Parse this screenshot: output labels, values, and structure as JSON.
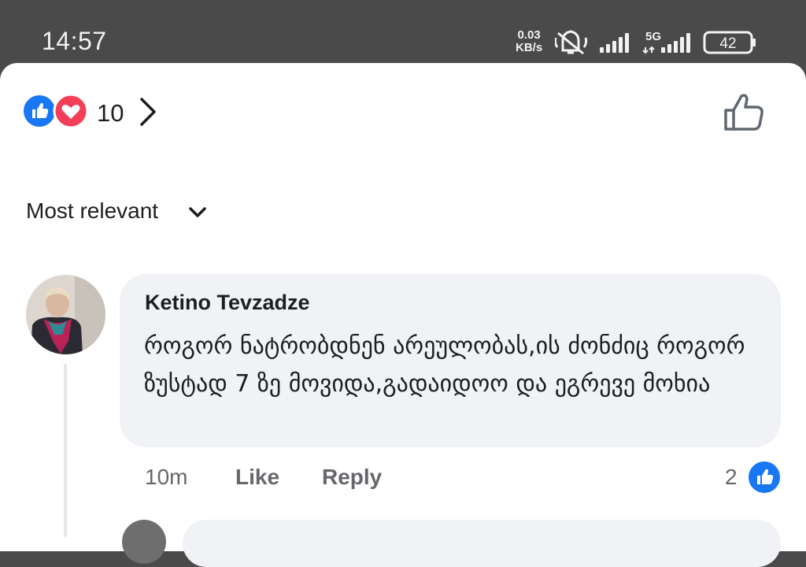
{
  "status_bar": {
    "time": "14:57",
    "net_speed_value": "0.03",
    "net_speed_unit": "KB/s",
    "network_type": "5G",
    "battery": "42",
    "icons": [
      "mute-icon",
      "signal-icon",
      "signal-5g-icon",
      "battery-icon"
    ]
  },
  "reactions": {
    "count": "10",
    "icons": [
      "like-reaction-icon",
      "love-reaction-icon",
      "chevron-right-icon"
    ],
    "colors": {
      "like": "#1877f2",
      "love": "#f33e58"
    }
  },
  "sort": {
    "label": "Most relevant"
  },
  "comment": {
    "author": "Ketino Tevzadze",
    "text": "როგორ ნატრობდნენ არეულობას,ის ძონძიც როგორ ზუსტად 7 ზე მოვიდა,გადაიდოო და ეგრევე მოხია",
    "time": "10m",
    "like_label": "Like",
    "reply_label": "Reply",
    "reaction_count": "2"
  },
  "colors": {
    "accent": "#1877f2",
    "bubble": "#f0f2f5",
    "muted_text": "#65676b"
  }
}
